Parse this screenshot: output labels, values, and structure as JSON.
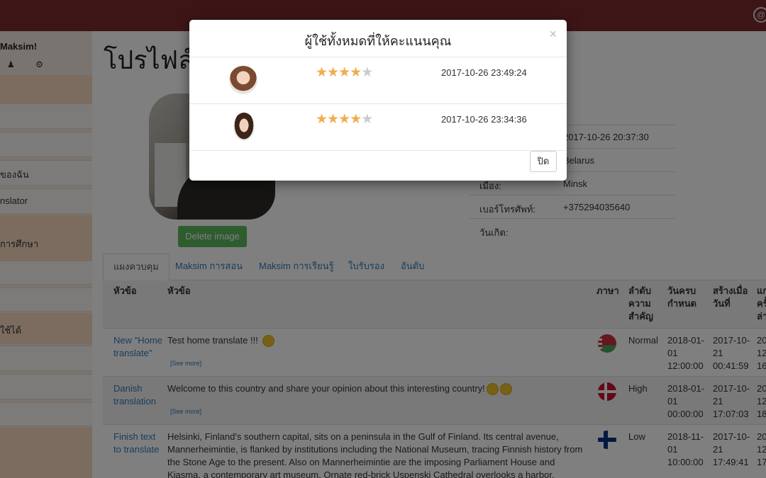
{
  "sidebar": {
    "greeting": "Maksim!",
    "items": [
      {
        "label": ""
      },
      {
        "label": ""
      },
      {
        "label": "ของฉัน"
      },
      {
        "label": "nslator"
      },
      {
        "label": "การศึกษา"
      },
      {
        "label": ""
      },
      {
        "label": ""
      },
      {
        "label": "ใช้ได้"
      }
    ]
  },
  "main": {
    "title": "โปรไฟล์",
    "delete_image": "Delete image",
    "info": [
      {
        "label": "",
        "value": "2017-10-26 20:37:30"
      },
      {
        "label": "",
        "value": "Belarus"
      },
      {
        "label": "เมือง:",
        "value": "Minsk"
      },
      {
        "label": "เบอร์โทรศัพท์:",
        "value": "+375294035640"
      },
      {
        "label": "วันเกิด:",
        "value": ""
      }
    ],
    "tabs": [
      "แผงควบคุม",
      "Maksim การสอน",
      "Maksim การเรียนรู้",
      "ใบรับรอง",
      "อันดับ"
    ],
    "table": {
      "headers": [
        "หัวข้อ",
        "หัวข้อ",
        "ภาษา",
        "ลำดับ ความ สำคัญ",
        "วันครบ กำหนด",
        "สร้างเมื่อ วันที่",
        "แก ครั้ ล่า"
      ],
      "rows": [
        {
          "title": "New \"Home translate\"",
          "text": "Test home translate !!!",
          "see_more": "[See more]",
          "priority": "Normal",
          "due": "2018-01-01 12:00:00",
          "created": "2017-10-21 00:41:59",
          "edited": "20 12 16"
        },
        {
          "title": "Danish translation",
          "text": "Welcome to this country and share your opinion about this interesting country!",
          "see_more": "[See more]",
          "priority": "High",
          "due": "2018-01-01 00:00:00",
          "created": "2017-10-21 17:07:03",
          "edited": "20 12 18"
        },
        {
          "title": "Finish text to translate",
          "text": "Helsinki, Finland's southern capital, sits on a peninsula in the Gulf of Finland. Its central avenue, Mannerheimintie, is flanked by institutions including the National Museum, tracing Finnish history from the Stone Age to the present. Also on Mannerheimintie are the imposing Parliament House and Kiasma, a contemporary art museum. Ornate red-brick Uspenski Cathedral overlooks a harbor.",
          "see_more": "",
          "priority": "Low",
          "due": "2018-11-01 10:00:00",
          "created": "2017-10-21 17:49:41",
          "edited": "20 12 17"
        }
      ]
    }
  },
  "modal": {
    "title": "ผู้ใช้ทั้งหมดที่ให้คะแนนคุณ",
    "close_x": "×",
    "ratings": [
      {
        "stars": 4,
        "date": "2017-10-26 23:49:24"
      },
      {
        "stars": 4,
        "date": "2017-10-26 23:34:36"
      }
    ],
    "close_button": "ปิด"
  },
  "colors": {
    "topbar": "#7a2a2e",
    "star": "#f0ad4e",
    "link": "#337ab7",
    "delete_button": "#5cb85c"
  }
}
